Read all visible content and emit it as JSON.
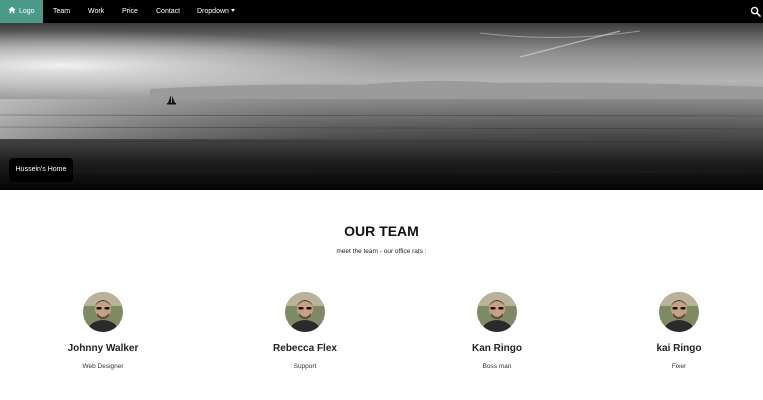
{
  "nav": {
    "logo": {
      "label": "Logo",
      "icon": "home-icon"
    },
    "items": [
      {
        "label": "Team"
      },
      {
        "label": "Work"
      },
      {
        "label": "Price"
      },
      {
        "label": "Contact"
      },
      {
        "label": "Dropdown",
        "icon": "caret-down-icon"
      }
    ],
    "search_icon": "search-icon",
    "accent_color": "#4a9a8a"
  },
  "hero": {
    "caption": "Hussein's Home"
  },
  "team": {
    "title": "OUR TEAM",
    "subtitle": "meet the team - our office rats :",
    "members": [
      {
        "name": "Johnny Walker",
        "role": "Web Designer"
      },
      {
        "name": "Rebecca Flex",
        "role": "Support"
      },
      {
        "name": "Kan Ringo",
        "role": "Boss man"
      },
      {
        "name": "kai Ringo",
        "role": "Fixer"
      }
    ]
  }
}
